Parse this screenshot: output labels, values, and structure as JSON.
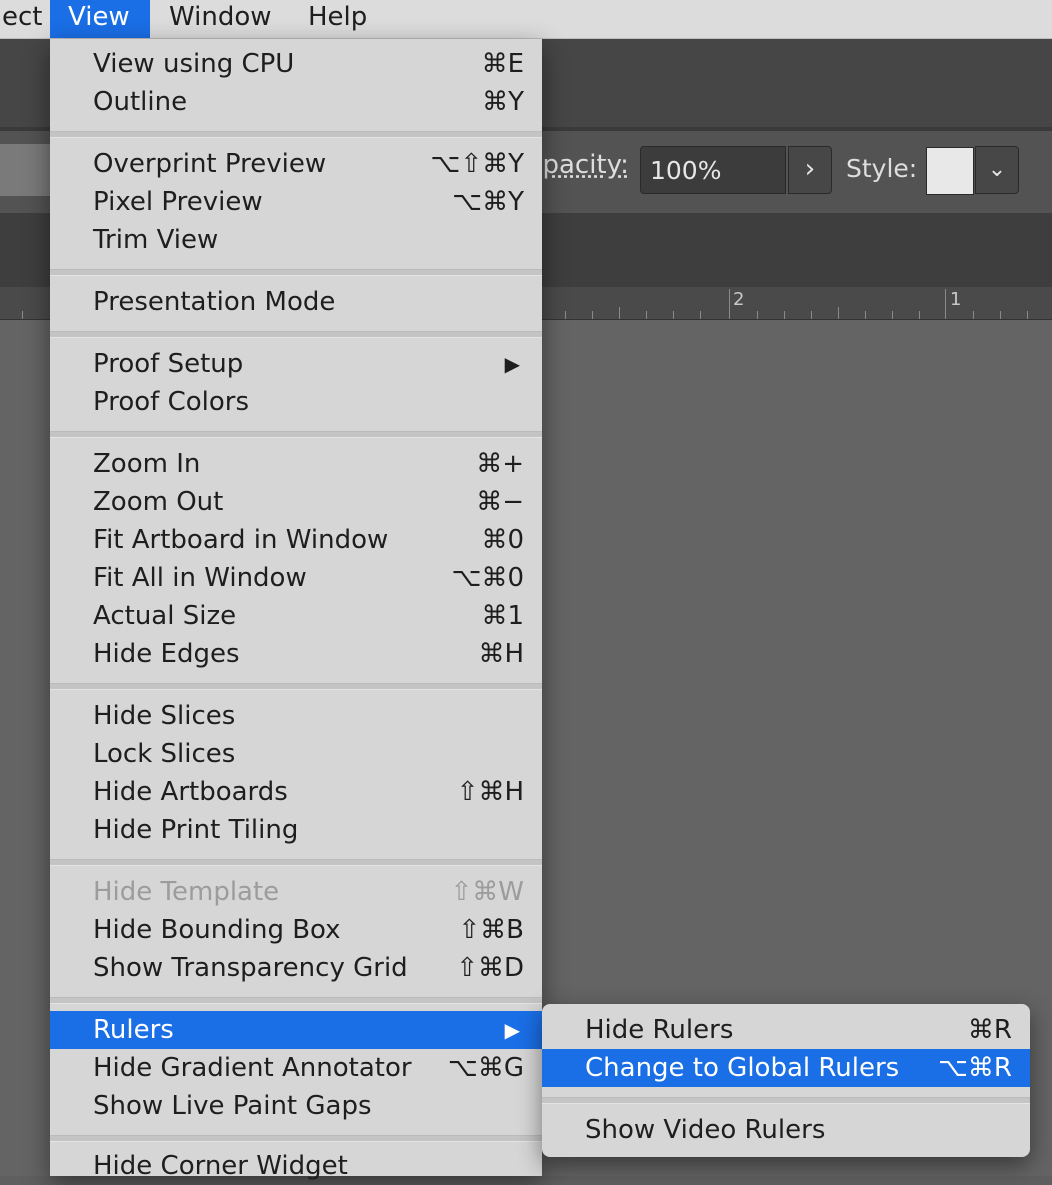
{
  "menubar": {
    "items": [
      {
        "label": "ect",
        "active": false
      },
      {
        "label": "View",
        "active": true
      },
      {
        "label": "Window",
        "active": false
      },
      {
        "label": "Help",
        "active": false
      }
    ]
  },
  "control_bar": {
    "opacity_label": "Opacity:",
    "opacity_value": "100%",
    "opacity_arrow": "›",
    "style_label": "Style:",
    "style_arrow": "⌄"
  },
  "ruler": {
    "labels": [
      "2",
      "1"
    ]
  },
  "view_menu": {
    "items": [
      {
        "label": "View using CPU",
        "shortcut": "⌘E"
      },
      {
        "label": "Outline",
        "shortcut": "⌘Y"
      },
      {
        "label": "Overprint Preview",
        "shortcut": "⌥⇧⌘Y"
      },
      {
        "label": "Pixel Preview",
        "shortcut": "⌥⌘Y"
      },
      {
        "label": "Trim View",
        "shortcut": ""
      },
      {
        "label": "Presentation Mode",
        "shortcut": ""
      },
      {
        "label": "Proof Setup",
        "shortcut": "",
        "submenu": true
      },
      {
        "label": "Proof Colors",
        "shortcut": ""
      },
      {
        "label": "Zoom In",
        "shortcut": "⌘+"
      },
      {
        "label": "Zoom Out",
        "shortcut": "⌘−"
      },
      {
        "label": "Fit Artboard in Window",
        "shortcut": "⌘0"
      },
      {
        "label": "Fit All in Window",
        "shortcut": "⌥⌘0"
      },
      {
        "label": "Actual Size",
        "shortcut": "⌘1"
      },
      {
        "label": "Hide Edges",
        "shortcut": "⌘H"
      },
      {
        "label": "Hide Slices",
        "shortcut": ""
      },
      {
        "label": "Lock Slices",
        "shortcut": ""
      },
      {
        "label": "Hide Artboards",
        "shortcut": "⇧⌘H"
      },
      {
        "label": "Hide Print Tiling",
        "shortcut": ""
      },
      {
        "label": "Hide Template",
        "shortcut": "⇧⌘W",
        "disabled": true
      },
      {
        "label": "Hide Bounding Box",
        "shortcut": "⇧⌘B"
      },
      {
        "label": "Show Transparency Grid",
        "shortcut": "⇧⌘D"
      },
      {
        "label": "Rulers",
        "shortcut": "",
        "submenu": true,
        "highlighted": true
      },
      {
        "label": "Hide Gradient Annotator",
        "shortcut": "⌥⌘G"
      },
      {
        "label": "Show Live Paint Gaps",
        "shortcut": ""
      },
      {
        "label": "Hide Corner Widget",
        "shortcut": ""
      }
    ],
    "submenu_arrow": "▶"
  },
  "rulers_submenu": {
    "items": [
      {
        "label": "Hide Rulers",
        "shortcut": "⌘R"
      },
      {
        "label": "Change to Global Rulers",
        "shortcut": "⌥⌘R",
        "highlighted": true
      },
      {
        "label": "Show Video Rulers",
        "shortcut": ""
      }
    ]
  },
  "colors": {
    "accent": "#1a6ee6",
    "menu_bg": "#d6d6d6",
    "canvas": "#646464"
  }
}
